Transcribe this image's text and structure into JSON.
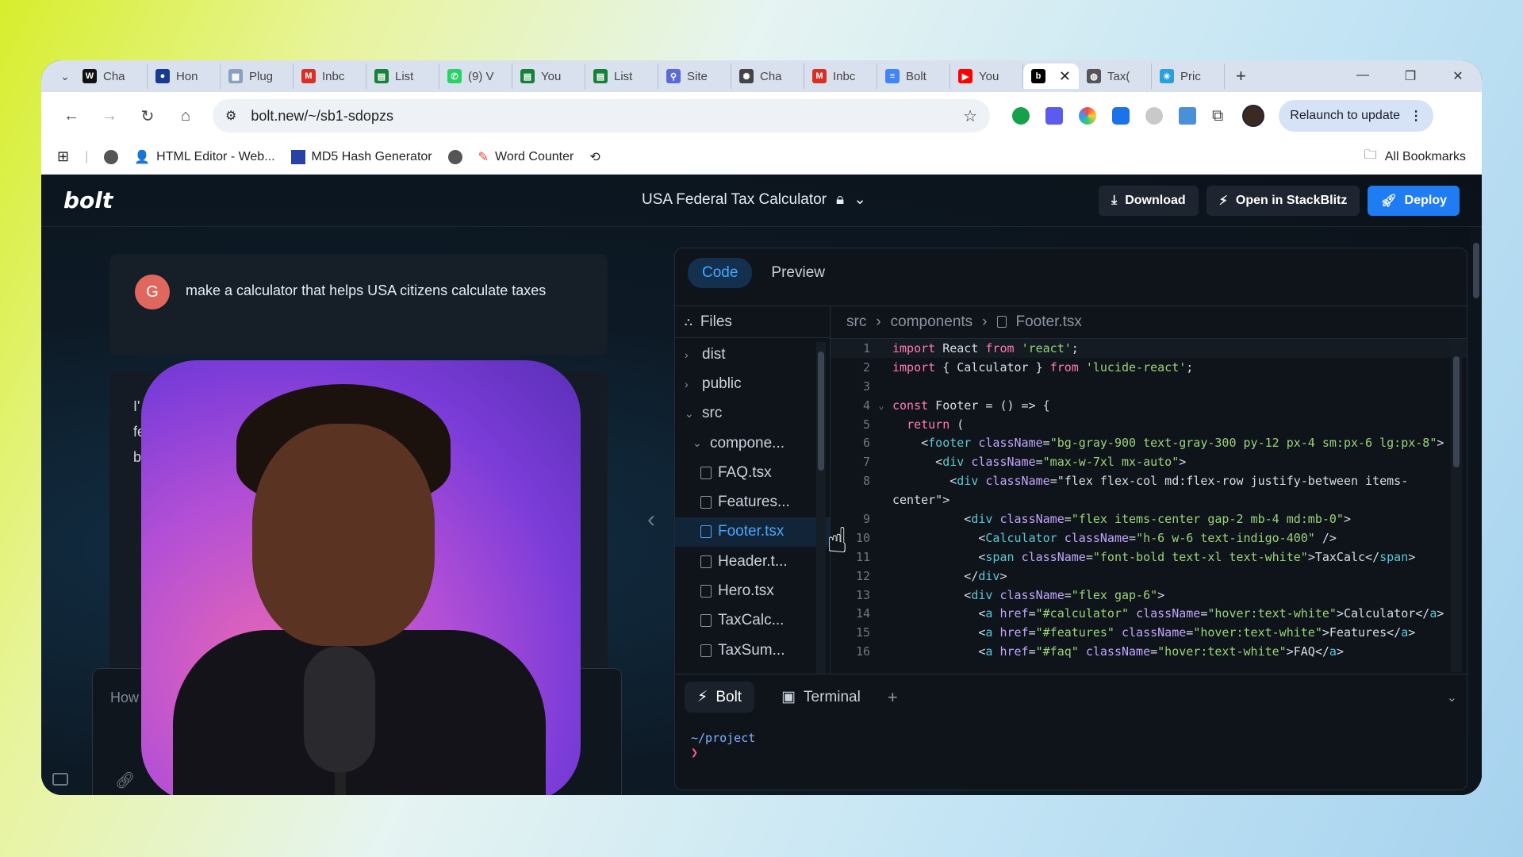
{
  "browser": {
    "tabs": [
      {
        "label": "Cha",
        "icon": "wikipedia-icon",
        "color": "#111111",
        "glyph": "W"
      },
      {
        "label": "Hon",
        "icon": "site-icon",
        "color": "#1a3a8f",
        "glyph": "●"
      },
      {
        "label": "Plug",
        "icon": "plugin-icon",
        "color": "#8aa0c0",
        "glyph": "▦"
      },
      {
        "label": "Inbc",
        "icon": "gmail-icon",
        "color": "#d93025",
        "glyph": "M"
      },
      {
        "label": "List",
        "icon": "sheets-icon",
        "color": "#188038",
        "glyph": "▤"
      },
      {
        "label": "(9) V",
        "icon": "whatsapp-icon",
        "color": "#25d366",
        "glyph": "✆"
      },
      {
        "label": "You",
        "icon": "sheets-icon",
        "color": "#188038",
        "glyph": "▤"
      },
      {
        "label": "List",
        "icon": "sheets-icon",
        "color": "#188038",
        "glyph": "▤"
      },
      {
        "label": "Site",
        "icon": "sitemap-icon",
        "color": "#5a6bd8",
        "glyph": "⚲"
      },
      {
        "label": "Cha",
        "icon": "chatgpt-icon",
        "color": "#444444",
        "glyph": "✺"
      },
      {
        "label": "Inbc",
        "icon": "gmail-icon",
        "color": "#d93025",
        "glyph": "M"
      },
      {
        "label": "Bolt",
        "icon": "docs-icon",
        "color": "#4285f4",
        "glyph": "≡"
      },
      {
        "label": "You",
        "icon": "youtube-icon",
        "color": "#ff0000",
        "glyph": "▶"
      },
      {
        "label": "",
        "icon": "bolt-icon",
        "color": "#000000",
        "glyph": "b",
        "active": true
      },
      {
        "label": "Tax(",
        "icon": "globe-icon",
        "color": "#555555",
        "glyph": "◍"
      },
      {
        "label": "Pric",
        "icon": "sparkle-icon",
        "color": "#2b9fd8",
        "glyph": "✳"
      }
    ],
    "url": "bolt.new/~/sb1-sdopzs",
    "relaunch_label": "Relaunch to update",
    "bookmarks": [
      {
        "label": "HTML Editor - Web..."
      },
      {
        "label": "MD5 Hash Generator"
      },
      {
        "label": ""
      },
      {
        "label": "Word Counter"
      }
    ],
    "all_bookmarks": "All Bookmarks"
  },
  "app": {
    "logo": "bolt",
    "project_title": "USA Federal Tax Calculator",
    "download_label": "Download",
    "stackblitz_label": "Open in StackBlitz",
    "deploy_label": "Deploy",
    "user_initial": "G",
    "user_message": "make a calculator that helps USA citizens calculate taxes",
    "response_fragments": [
      "I'",
      "fe",
      "b"
    ],
    "input_placeholder": "How",
    "code_tab": "Code",
    "preview_tab": "Preview",
    "files_label": "Files",
    "breadcrumb": [
      "src",
      "components",
      "Footer.tsx"
    ],
    "tree": [
      {
        "label": "dist",
        "type": "folder",
        "open": false,
        "depth": 0
      },
      {
        "label": "public",
        "type": "folder",
        "open": false,
        "depth": 0
      },
      {
        "label": "src",
        "type": "folder",
        "open": true,
        "depth": 0
      },
      {
        "label": "compone...",
        "type": "folder",
        "open": true,
        "depth": 1
      },
      {
        "label": "FAQ.tsx",
        "type": "file",
        "depth": 2
      },
      {
        "label": "Features...",
        "type": "file",
        "depth": 2
      },
      {
        "label": "Footer.tsx",
        "type": "file",
        "depth": 2,
        "selected": true
      },
      {
        "label": "Header.t...",
        "type": "file",
        "depth": 2
      },
      {
        "label": "Hero.tsx",
        "type": "file",
        "depth": 2
      },
      {
        "label": "TaxCalc...",
        "type": "file",
        "depth": 2
      },
      {
        "label": "TaxSum...",
        "type": "file",
        "depth": 2
      }
    ],
    "code_lines": [
      {
        "n": "1",
        "text": "import React from 'react';"
      },
      {
        "n": "2",
        "text": "import { Calculator } from 'lucide-react';"
      },
      {
        "n": "3",
        "text": ""
      },
      {
        "n": "4",
        "text": "const Footer = () => {",
        "fold": true
      },
      {
        "n": "5",
        "text": "  return ("
      },
      {
        "n": "6",
        "text": "    <footer className=\"bg-gray-900 text-gray-300 py-12 px-4 sm:px-6 lg:px-8\">"
      },
      {
        "n": "7",
        "text": "      <div className=\"max-w-7xl mx-auto\">"
      },
      {
        "n": "8",
        "text": "        <div className=\"flex flex-col md:flex-row justify-between items-"
      },
      {
        "n": "",
        "text": "center\">"
      },
      {
        "n": "9",
        "text": "          <div className=\"flex items-center gap-2 mb-4 md:mb-0\">"
      },
      {
        "n": "10",
        "text": "            <Calculator className=\"h-6 w-6 text-indigo-400\" />"
      },
      {
        "n": "11",
        "text": "            <span className=\"font-bold text-xl text-white\">TaxCalc</span>"
      },
      {
        "n": "12",
        "text": "          </div>"
      },
      {
        "n": "13",
        "text": "          <div className=\"flex gap-6\">"
      },
      {
        "n": "14",
        "text": "            <a href=\"#calculator\" className=\"hover:text-white\">Calculator</a>"
      },
      {
        "n": "15",
        "text": "            <a href=\"#features\" className=\"hover:text-white\">Features</a>"
      },
      {
        "n": "16",
        "text": "            <a href=\"#faq\" className=\"hover:text-white\">FAQ</a>"
      }
    ],
    "bolt_tab": "Bolt",
    "terminal_tab": "Terminal",
    "terminal_path": "~/project",
    "terminal_prompt": "❯"
  },
  "colors": {
    "accent": "#1f7cf2",
    "selected_file": "#4aa5ff",
    "keyword": "#ff7ab6",
    "string": "#9ad27a",
    "tag": "#5bc8d6",
    "attr": "#c1a4ff"
  }
}
